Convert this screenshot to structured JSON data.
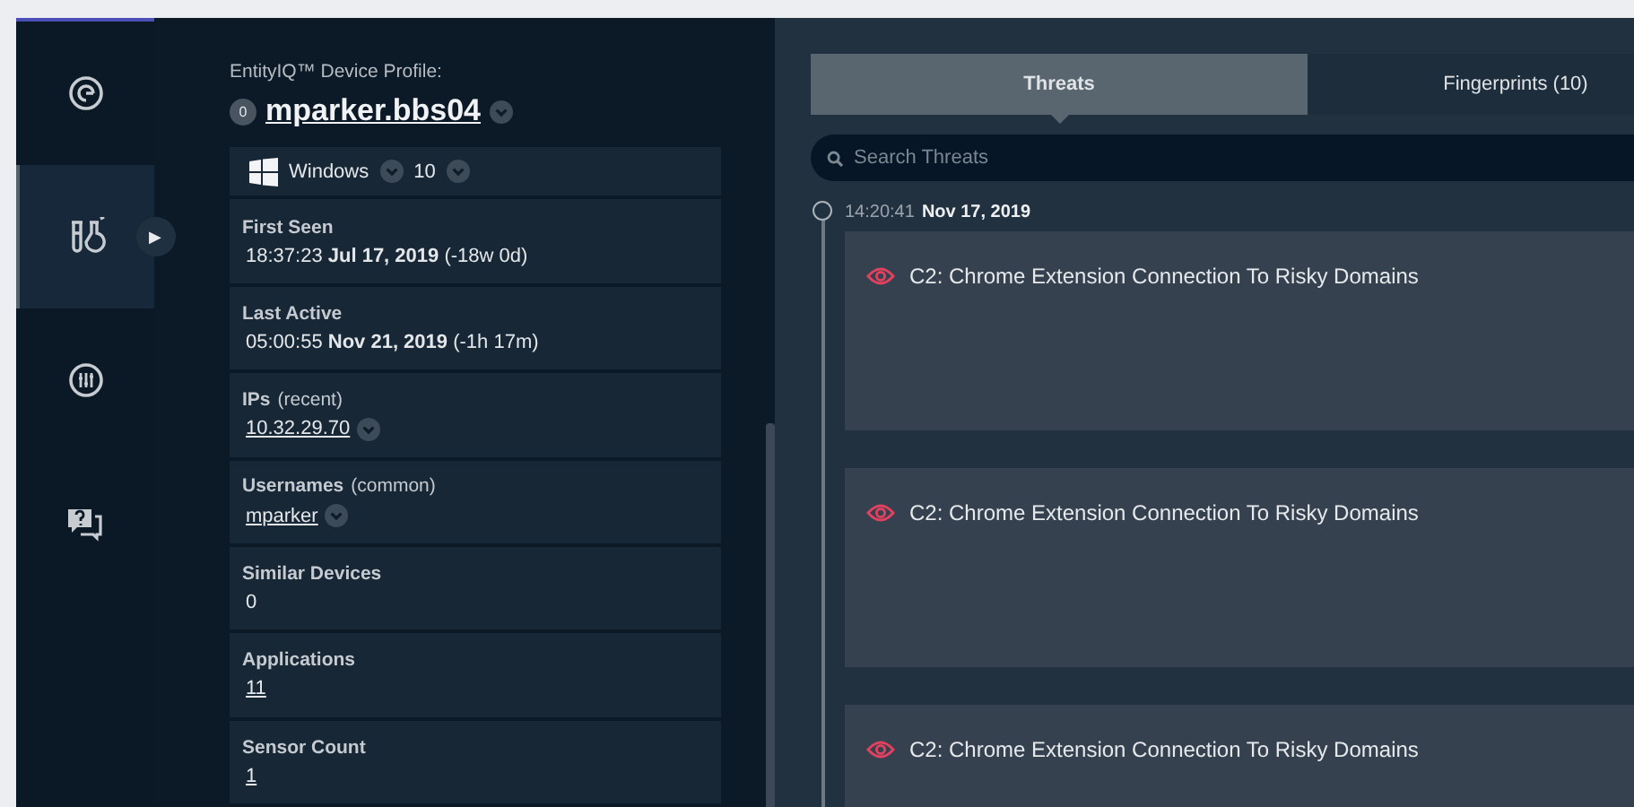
{
  "nav": {
    "items": [
      {
        "kind": "gauge",
        "selected": false
      },
      {
        "kind": "lab",
        "selected": true,
        "expander": "▶"
      },
      {
        "kind": "sliders",
        "selected": false
      },
      {
        "kind": "help",
        "selected": false
      }
    ]
  },
  "profile": {
    "heading": "EntityIQ™ Device Profile:",
    "badge": "0",
    "device_name": "mparker.bbs04",
    "os": {
      "name": "Windows",
      "version": "10"
    },
    "fields": [
      {
        "label": "First Seen",
        "value": "18:37:23  **Jul 17, 2019** (-18w 0d)",
        "kind": "text"
      },
      {
        "label": "Last Active",
        "value": "05:00:55  **Nov 21, 2019** (-1h 17m)",
        "kind": "text"
      },
      {
        "label": "IPs",
        "note": "(recent)",
        "value": "10.32.29.70",
        "kind": "link-dropdown"
      },
      {
        "label": "Usernames",
        "note": "(common)",
        "value": "mparker",
        "kind": "link-dropdown"
      },
      {
        "label": "Similar Devices",
        "value": "0",
        "kind": "text"
      },
      {
        "label": "Applications",
        "value": "11",
        "kind": "link"
      },
      {
        "label": "Sensor Count",
        "value": "1",
        "kind": "link"
      }
    ]
  },
  "threats_panel": {
    "tabs": [
      {
        "label": "Threats",
        "selected": true
      },
      {
        "label": "Fingerprints (10)",
        "selected": false
      }
    ],
    "search": {
      "placeholder": "Search Threats"
    },
    "group": {
      "time": "14:20:41",
      "date": "Nov 17, 2019"
    },
    "threats": [
      {
        "title": "C2: Chrome Extension Connection To Risky Domains"
      },
      {
        "title": "C2: Chrome Extension Connection To Risky Domains"
      },
      {
        "title": "C2: Chrome Extension Connection To Risky Domains"
      }
    ]
  }
}
